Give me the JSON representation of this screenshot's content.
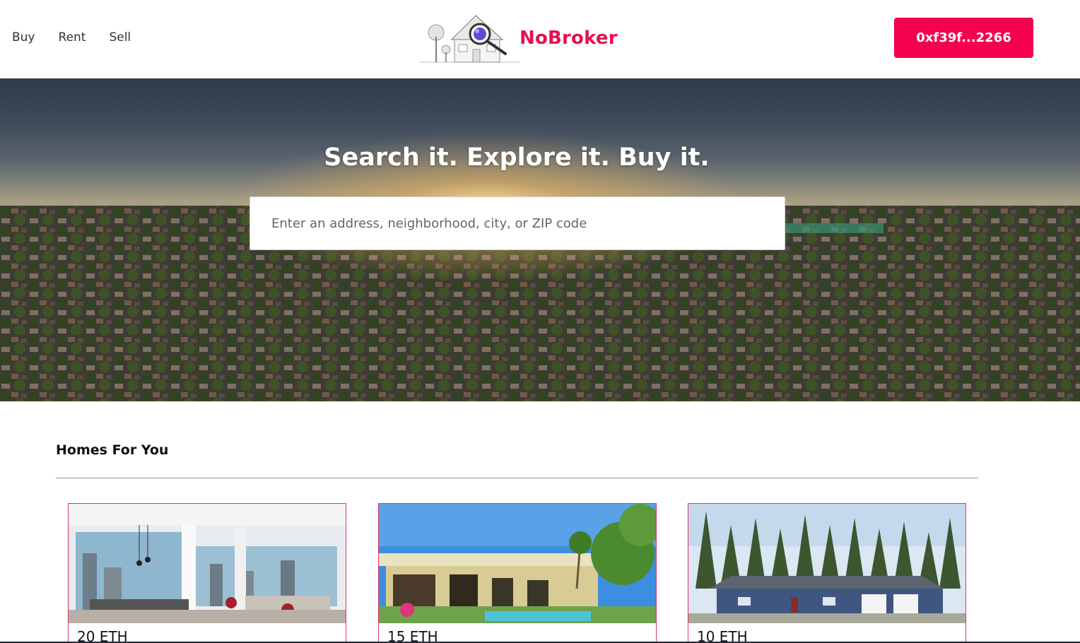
{
  "header": {
    "nav": [
      {
        "label": "Buy"
      },
      {
        "label": "Rent"
      },
      {
        "label": "Sell"
      }
    ],
    "brand_name": "NoBroker",
    "wallet_label": "0xf39f...2266"
  },
  "hero": {
    "title": "Search it. Explore it. Buy it.",
    "search_placeholder": "Enter an address, neighborhood, city, or ZIP code"
  },
  "homes": {
    "section_title": "Homes For You",
    "cards": [
      {
        "price": "20 ETH",
        "photo": "apartment-interior-photo"
      },
      {
        "price": "15 ETH",
        "photo": "house-with-pool-photo"
      },
      {
        "price": "10 ETH",
        "photo": "house-with-trees-photo"
      }
    ]
  },
  "colors": {
    "brand": "#e8114f",
    "button": "#f5024f",
    "card_border": "#e0356e"
  }
}
